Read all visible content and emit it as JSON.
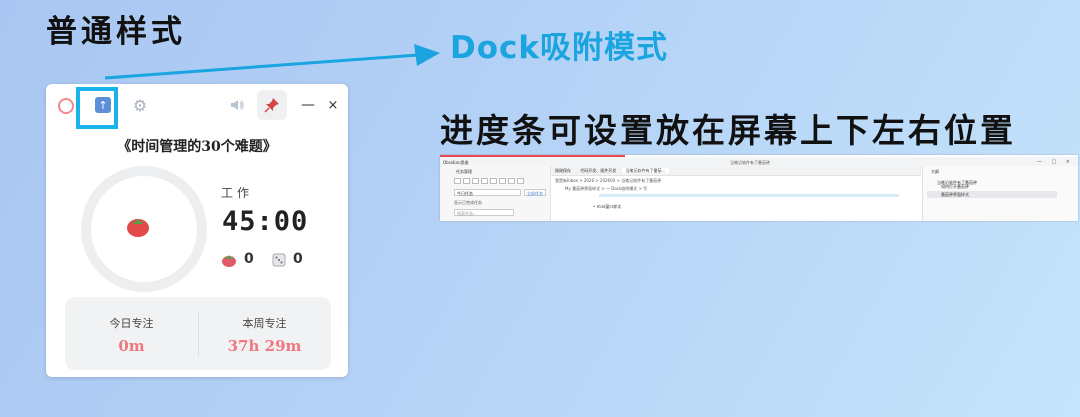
{
  "annotations": {
    "normal_mode": "普通样式",
    "dock_mode": "Dock吸附模式",
    "progress_note": "进度条可设置放在屏幕上下左右位置"
  },
  "widget": {
    "icons": {
      "ring": "ring-icon",
      "dock": "dock-arrow-up-icon",
      "settings": "gear-icon",
      "sound": "speaker-icon",
      "pin": "pin-icon",
      "minimize": "minimize-icon",
      "close": "close-icon"
    },
    "minimize_glyph": "—",
    "close_glyph": "×",
    "task_title": "《时间管理的30个难题》",
    "mode_label": "工作",
    "time": "45:00",
    "tomato_count": "0",
    "interrupt_count": "0",
    "stats": {
      "today_label": "今日专注",
      "today_value": "0m",
      "week_label": "本周专注",
      "week_value": "37h 29m"
    },
    "colors": {
      "accent": "#f0777f",
      "dock_highlight": "#18b3ea",
      "pin": "#d64545"
    }
  },
  "browser": {
    "progress_fraction": 0.29,
    "app_name": "Obsidian思维",
    "window_title": "当笔记软件有了番茄钟",
    "sidebar_title": "任务管理",
    "sidebar_select": "今日任务",
    "sidebar_button": "全部任务",
    "sidebar_row": "显示已完成任务",
    "sidebar_search": "搜索任务...",
    "tabs": [
      "刚刚保存",
      "代码开发、插件开发",
      "当笔记软件有了番茄..."
    ],
    "breadcrumb": "我是新Inbox > 2026 > 202604 > 当笔记软件有了番茄钟",
    "path2": "My 番茄钟界面样式 > — Dock吸附模式 > 写",
    "bullet": "mini窗口样式",
    "outline_title": "大纲",
    "outline_items": [
      "当笔记软件有了番茄钟",
      "如何打开番茄钟",
      "番茄钟界面样式"
    ]
  }
}
